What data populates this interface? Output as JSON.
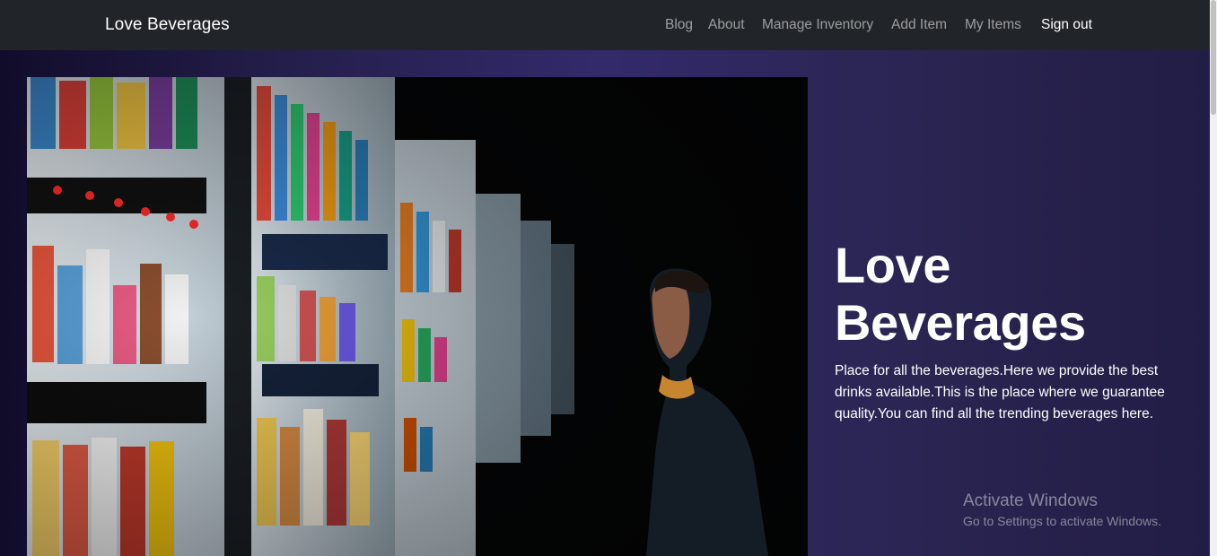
{
  "navbar": {
    "brand": "Love Beverages",
    "links": [
      {
        "label": "Blog"
      },
      {
        "label": "About"
      },
      {
        "label": "Manage Inventory"
      },
      {
        "label": "Add Item"
      },
      {
        "label": "My Items"
      }
    ],
    "signout_label": "Sign out"
  },
  "hero": {
    "image_icon": "vending-machine-photo",
    "title": "Love Beverages",
    "description": "Place for all the beverages.Here we provide the best drinks available.This is the place where we guarantee quality.You can find all the trending beverages here."
  },
  "os_watermark": {
    "title": "Activate Windows",
    "subtitle": "Go to Settings to activate Windows."
  },
  "colors": {
    "navbar_bg": "#212529",
    "hero_bg": "#2a2552",
    "link_muted": "#8c8e91",
    "link_active": "#ffffff"
  }
}
